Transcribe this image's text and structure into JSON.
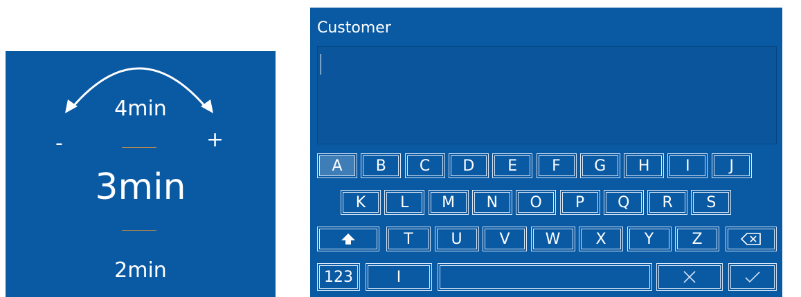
{
  "duration_picker": {
    "decrement_label": "-",
    "increment_label": "+",
    "upper_value": "4min",
    "selected_value": "3min",
    "lower_value": "2min"
  },
  "keyboard_panel": {
    "title": "Customer",
    "input_value": "",
    "rows": [
      [
        "A",
        "B",
        "C",
        "D",
        "E",
        "F",
        "G",
        "H",
        "I",
        "J"
      ],
      [
        "K",
        "L",
        "M",
        "N",
        "O",
        "P",
        "Q",
        "R",
        "S"
      ],
      [
        "T",
        "U",
        "V",
        "W",
        "X",
        "Y",
        "Z"
      ]
    ],
    "active_key": "A",
    "numbers_key_label": "123",
    "text_cursor_key_label": "I",
    "shift_icon": "shift-up-arrow-icon",
    "backspace_icon": "backspace-icon",
    "cancel_icon": "cross-icon",
    "confirm_icon": "check-icon"
  }
}
